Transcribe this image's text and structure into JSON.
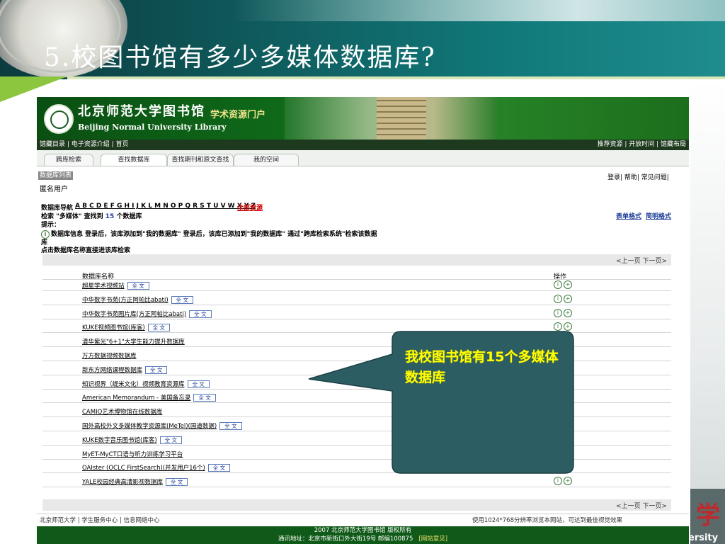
{
  "slide": {
    "title": "5.校图书馆有多少多媒体数据库?",
    "deco_char": "学",
    "deco_text": "ersity"
  },
  "library": {
    "name_cn": "北京师范大学图书馆",
    "name_en": "Beijing Normal University Library",
    "portal_title": "学术资源门户",
    "topnav_left": "馆藏目录 | 电子资源介绍 | 首页",
    "topnav_right": "推荐资源 | 开放时间 | 馆藏布局",
    "tabs": [
      "跨库检索",
      "查找数据库",
      "查找期刊和原文查找",
      "我的空间"
    ],
    "active_tab": "查找数据库"
  },
  "content": {
    "section_label": "数据库列表",
    "user": "匿名用户",
    "top_right_links": "登录| 帮助| 常见问题|",
    "nav_label": "数据库导航",
    "letters": "A B C D E F G H I J K L M N O P Q R S T U V W X Y Z",
    "all_resources": "全部资源",
    "search_result_prefix": "检索 \"多媒体\" 查找到",
    "result_count": "15",
    "search_result_suffix": "个数据库",
    "view_table": "表单格式",
    "view_brief": "简明格式",
    "hint_label": "提示：",
    "hint_line1": "数据库信息  登录后，该库添加到\"我的数据库\"  登录后，该库已添加到\"我的数据库\"  通过\"跨库检索系统\"检索该数据",
    "hint_line1_tail": "库",
    "hint_line2": "点击数据库名称直接进该库检索",
    "pager": "<上一页  下一页>",
    "col_name": "数据库名称",
    "col_ops": "操作",
    "fulltext": "全  文",
    "databases": [
      {
        "name": "超星学术视频站",
        "fulltext": true
      },
      {
        "name": "中华数字书苑(方正阿帕比abati)",
        "fulltext": true
      },
      {
        "name": "中华数字书苑图片库(方正阿帕比abati)",
        "fulltext": true
      },
      {
        "name": "KUKE视频图书馆(库客)",
        "fulltext": true
      },
      {
        "name": "清华紫光\"6+1\"大学生能力提升数据库",
        "fulltext": false
      },
      {
        "name": "万方数据视频数据库",
        "fulltext": false
      },
      {
        "name": "新东方网络课程数据库",
        "fulltext": true
      },
      {
        "name": "知识视界（缇米文化）视频教育资源库",
        "fulltext": true
      },
      {
        "name": "American Memorandum - 美国备忘录",
        "fulltext": true
      },
      {
        "name": "CAMIO艺术博物馆在线数据库",
        "fulltext": false
      },
      {
        "name": "国外高校外文多媒体教学资源库(MeTel)(国道数据)",
        "fulltext": true
      },
      {
        "name": "KUKE数字音乐图书馆(库客)",
        "fulltext": true
      },
      {
        "name": "MyET-MyCT口语与听力训练学习平台",
        "fulltext": false
      },
      {
        "name": "OAIster (OCLC FirstSearch)(并发用户16个)",
        "fulltext": true
      },
      {
        "name": "YALE校园经典高清影视数据库",
        "fulltext": true
      }
    ]
  },
  "footer": {
    "left": "北京师范大学 | 学生服务中心 | 信息网络中心",
    "right": "使用1024*768分辨率浏览本网站，可达到最佳视觉效果",
    "copyright": "2007 北京师范大学图书馆 版权所有",
    "address": "通讯地址：北京市新街口外大街19号  邮编100875",
    "feedback": "[网站意见]"
  },
  "callout": {
    "text": "我校图书馆有15个多媒体数据库"
  },
  "colors": {
    "slide_teal": "#0f5a5c",
    "lib_green": "#106b1a",
    "callout_fill": "#2b5d62",
    "callout_text": "#ffff00"
  }
}
